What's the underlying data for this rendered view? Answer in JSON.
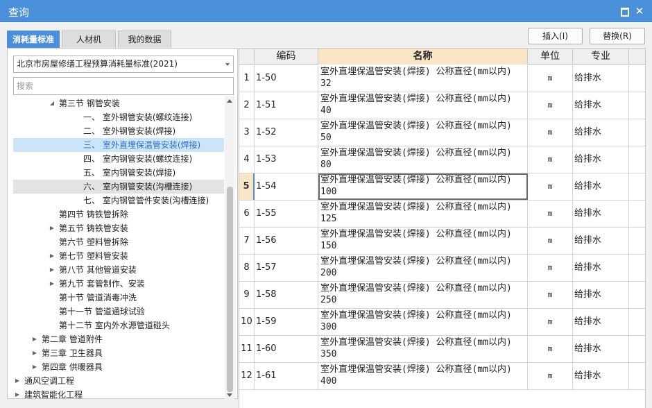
{
  "window": {
    "title": "查询"
  },
  "tabs": [
    {
      "label": "消耗量标准",
      "active": true
    },
    {
      "label": "人材机",
      "active": false
    },
    {
      "label": "我的数据",
      "active": false
    }
  ],
  "toolbar": {
    "insert_label": "插入(I)",
    "replace_label": "替换(R)"
  },
  "library_select": {
    "value": "北京市房屋修缮工程预算消耗量标准(2021)"
  },
  "search": {
    "placeholder": "搜索"
  },
  "tree": [
    {
      "label": "第三节 钢管安装",
      "indent": 3,
      "arrow": "expanded",
      "state": ""
    },
    {
      "label": "一、 室外钢管安装(螺纹连接)",
      "indent": 4,
      "arrow": "",
      "state": ""
    },
    {
      "label": "二、 室外钢管安装(焊接)",
      "indent": 4,
      "arrow": "",
      "state": ""
    },
    {
      "label": "三、 室外直埋保温管安装(焊接)",
      "indent": 4,
      "arrow": "",
      "state": "selected"
    },
    {
      "label": "四、 室内钢管安装(螺纹连接)",
      "indent": 4,
      "arrow": "",
      "state": ""
    },
    {
      "label": "五、 室内钢管安装(焊接)",
      "indent": 4,
      "arrow": "",
      "state": ""
    },
    {
      "label": "六、 室内钢管安装(沟槽连接)",
      "indent": 4,
      "arrow": "",
      "state": "hover"
    },
    {
      "label": "七、 室内钢管管件安装(沟槽连接)",
      "indent": 4,
      "arrow": "",
      "state": ""
    },
    {
      "label": "第四节 铸铁管拆除",
      "indent": 3,
      "arrow": "",
      "state": ""
    },
    {
      "label": "第五节 铸铁管安装",
      "indent": 3,
      "arrow": "collapsed",
      "state": ""
    },
    {
      "label": "第六节 塑料管拆除",
      "indent": 3,
      "arrow": "",
      "state": ""
    },
    {
      "label": "第七节 塑料管安装",
      "indent": 3,
      "arrow": "collapsed",
      "state": ""
    },
    {
      "label": "第八节 其他管道安装",
      "indent": 3,
      "arrow": "collapsed",
      "state": ""
    },
    {
      "label": "第九节 套管制作、安装",
      "indent": 3,
      "arrow": "collapsed",
      "state": ""
    },
    {
      "label": "第十节 管道消毒冲洗",
      "indent": 3,
      "arrow": "",
      "state": ""
    },
    {
      "label": "第十一节 管道通球试验",
      "indent": 3,
      "arrow": "",
      "state": ""
    },
    {
      "label": "第十二节 室内外水源管道碰头",
      "indent": 3,
      "arrow": "",
      "state": ""
    },
    {
      "label": "第二章 管道附件",
      "indent": 2,
      "arrow": "collapsed",
      "state": ""
    },
    {
      "label": "第三章 卫生器具",
      "indent": 2,
      "arrow": "collapsed",
      "state": ""
    },
    {
      "label": "第四章 供暖器具",
      "indent": 2,
      "arrow": "collapsed",
      "state": ""
    },
    {
      "label": "通风空调工程",
      "indent": 1,
      "arrow": "collapsed",
      "state": ""
    },
    {
      "label": "建筑智能化工程",
      "indent": 1,
      "arrow": "collapsed",
      "state": ""
    }
  ],
  "grid": {
    "columns": [
      "",
      "编码",
      "名称",
      "单位",
      "专业"
    ],
    "rows": [
      {
        "num": "1",
        "code": "1-50",
        "name": "室外直埋保温管安装(焊接) 公称直径(mm以内) 32",
        "unit": "m",
        "major": "给排水"
      },
      {
        "num": "2",
        "code": "1-51",
        "name": "室外直埋保温管安装(焊接) 公称直径(mm以内) 40",
        "unit": "m",
        "major": "给排水"
      },
      {
        "num": "3",
        "code": "1-52",
        "name": "室外直埋保温管安装(焊接) 公称直径(mm以内) 50",
        "unit": "m",
        "major": "给排水"
      },
      {
        "num": "4",
        "code": "1-53",
        "name": "室外直埋保温管安装(焊接) 公称直径(mm以内) 80",
        "unit": "m",
        "major": "给排水"
      },
      {
        "num": "5",
        "code": "1-54",
        "name": "室外直埋保温管安装(焊接) 公称直径(mm以内) 100",
        "unit": "m",
        "major": "给排水"
      },
      {
        "num": "6",
        "code": "1-55",
        "name": "室外直埋保温管安装(焊接) 公称直径(mm以内) 125",
        "unit": "m",
        "major": "给排水"
      },
      {
        "num": "7",
        "code": "1-56",
        "name": "室外直埋保温管安装(焊接) 公称直径(mm以内) 150",
        "unit": "m",
        "major": "给排水"
      },
      {
        "num": "8",
        "code": "1-57",
        "name": "室外直埋保温管安装(焊接) 公称直径(mm以内) 200",
        "unit": "m",
        "major": "给排水"
      },
      {
        "num": "9",
        "code": "1-58",
        "name": "室外直埋保温管安装(焊接) 公称直径(mm以内) 250",
        "unit": "m",
        "major": "给排水"
      },
      {
        "num": "10",
        "code": "1-59",
        "name": "室外直埋保温管安装(焊接) 公称直径(mm以内) 300",
        "unit": "m",
        "major": "给排水"
      },
      {
        "num": "11",
        "code": "1-60",
        "name": "室外直埋保温管安装(焊接) 公称直径(mm以内) 350",
        "unit": "m",
        "major": "给排水"
      },
      {
        "num": "12",
        "code": "1-61",
        "name": "室外直埋保温管安装(焊接) 公称直径(mm以内) 400",
        "unit": "m",
        "major": "给排水"
      }
    ],
    "current_row": "5"
  },
  "colors": {
    "accent": "#4a8fd9",
    "selected_row": "#cce4f7",
    "header_highlight": "#fbe5c7"
  }
}
